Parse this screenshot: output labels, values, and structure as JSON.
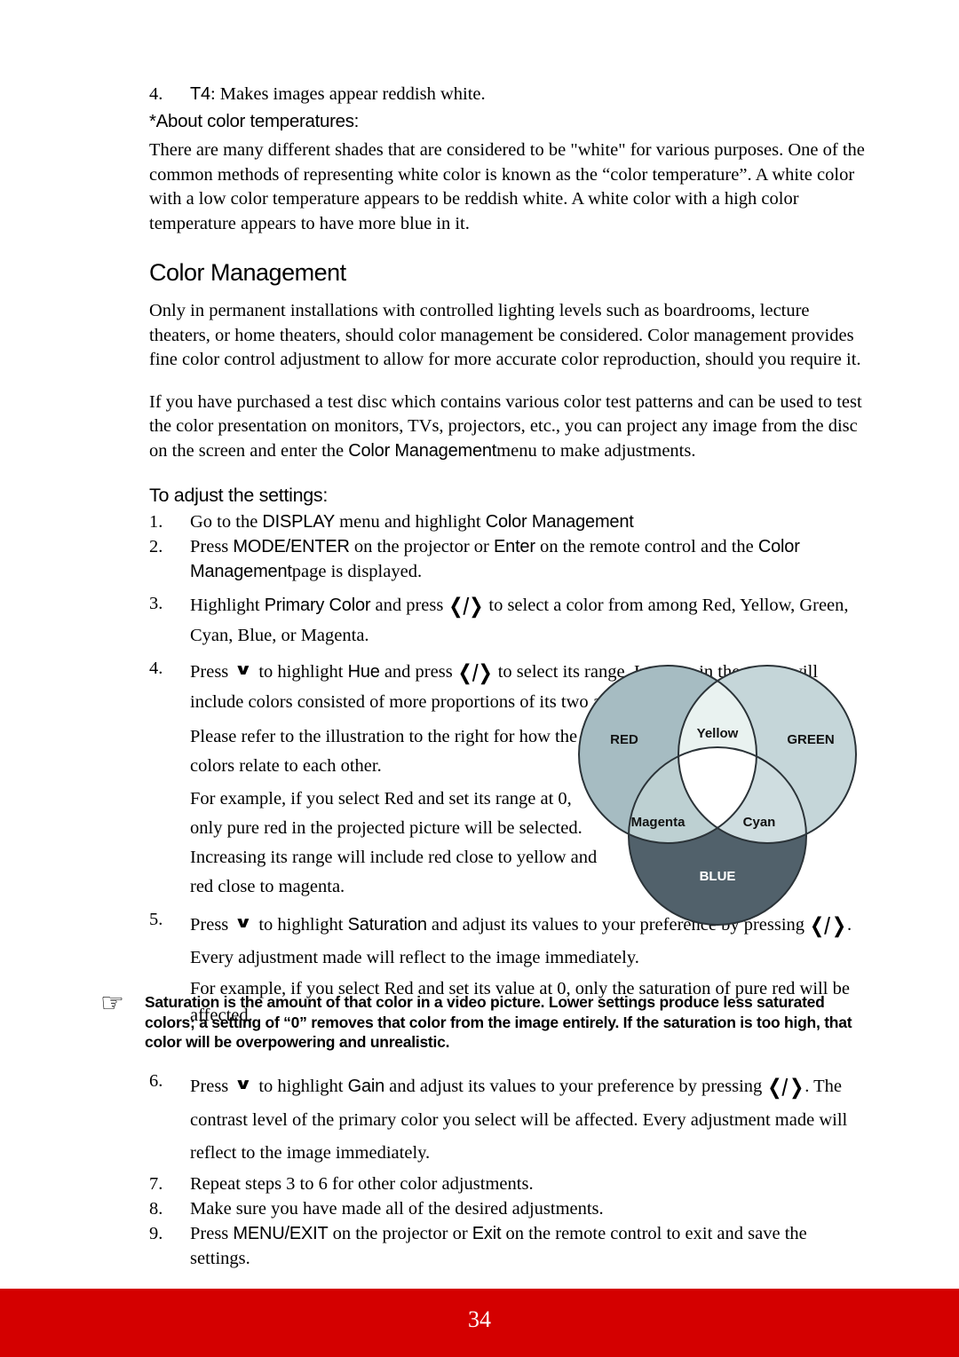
{
  "document": {
    "page_number": "34",
    "footer_color": "#d40000"
  },
  "top": {
    "item4_number": "4.",
    "item4_term": "T4",
    "item4_text": ": Makes images appear reddish white.",
    "about_heading": "*About color temperatures:",
    "about_paragraph": "There are many different shades that are considered to be \"white\" for various purposes. One of the common methods of representing white color is known as the “color temperature”. A white color with a low color temperature appears to be reddish white. A white color with a high color temperature appears to have more blue in it."
  },
  "section": {
    "heading": "Color Management",
    "paragraph1": "Only in permanent installations with controlled lighting levels such as boardrooms, lecture theaters, or home theaters, should color management be considered. Color management provides fine color control adjustment to allow for more accurate color reproduction, should you require it.",
    "paragraph2_a": "If you have purchased a test disc which contains various color test patterns and can be used to test the color presentation on monitors, TVs, projectors, etc., you can project any image from the disc on the screen and enter the ",
    "paragraph2_menu": "Color Management",
    "paragraph2_b": "menu to make adjustments.",
    "adjust_title": "To adjust the settings:"
  },
  "steps": {
    "s1": {
      "marker": "1.",
      "a": "Go to the ",
      "ui1": "DISPLAY",
      "b": " menu and highlight ",
      "ui2": "Color Management"
    },
    "s2": {
      "marker": "2.",
      "a": "Press ",
      "ui1": "MODE/ENTER",
      "b": " on the projector or ",
      "ui2": "Enter",
      "c": " on the remote control and the ",
      "ui3": "Color Management",
      "d": "page is displayed."
    },
    "s3": {
      "marker": "3.",
      "a": "Highlight ",
      "ui1": "Primary Color",
      "b": " and press ",
      "chev": "❮/❯",
      "c": " to select a color from among Red, Yellow, Green, Cyan, Blue, or Magenta."
    },
    "s4": {
      "marker": "4.",
      "a": "Press ",
      "down": "∨",
      "b": " to highlight ",
      "ui1": "Hue",
      "c": " and press ",
      "chev": "❮/❯",
      "d": " to select its range. Increase in the range will include colors consisted of more proportions of its two adjacent colors.",
      "e": "Please refer to the illustration to the right for how the colors relate to each other.",
      "f": "For example, if you select Red and set its range at 0, only pure red in the projected picture will be selected. Increasing its range will include red close to yellow and red close to magenta."
    },
    "s5": {
      "marker": "5.",
      "a": "Press ",
      "down": "∨",
      "b": " to highlight ",
      "ui1": "Saturation",
      "c": " and adjust its values to your preference by pressing ",
      "chev_l": "❮/",
      "chev_r": "❯",
      "d": ". Every adjustment made will reflect to the image immediately.",
      "e": "For example, if you select Red and set its value at 0, only the saturation of pure red will be affected."
    },
    "s6": {
      "marker": "6.",
      "a": "Press ",
      "down": "∨",
      "b": " to highlight ",
      "ui1": "Gain",
      "c": " and adjust its values to your preference by pressing ",
      "chev_l": "❮/",
      "chev_r": "❯",
      "d": ". The contrast level of the primary color you select will be affected. Every adjustment made will reflect to the image immediately."
    },
    "s7": {
      "marker": "7.",
      "text": "Repeat steps 3 to 6 for other color adjustments."
    },
    "s8": {
      "marker": "8.",
      "text": "Make sure you have made all of the desired adjustments."
    },
    "s9": {
      "marker": "9.",
      "a": "Press ",
      "ui1": "MENU/EXIT",
      "b": " on the projector or ",
      "ui2": "Exit",
      "c": " on the remote control to exit and save the settings."
    }
  },
  "note": {
    "icon": "pointing-hand-icon",
    "glyph": "☞",
    "text": "Saturation is the amount of that color in a video picture. Lower settings produce less saturated colors; a setting of “0” removes that color from the image entirely. If the saturation is too high, that color will be overpowering and unrealistic."
  },
  "venn": {
    "labels": {
      "red": "RED",
      "green": "GREEN",
      "blue": "BLUE",
      "yellow": "Yellow",
      "cyan": "Cyan",
      "magenta": "Magenta"
    },
    "colors": {
      "red_circle": "#a6bcc2",
      "green_circle": "#c5d6d9",
      "blue_circle": "#51616b",
      "yellow_overlap": "#e9f2f0",
      "cyan_overlap": "#cfdde0",
      "magenta_overlap": "#bdd0d2",
      "center": "#ffffff",
      "stroke": "#2b3338"
    }
  }
}
